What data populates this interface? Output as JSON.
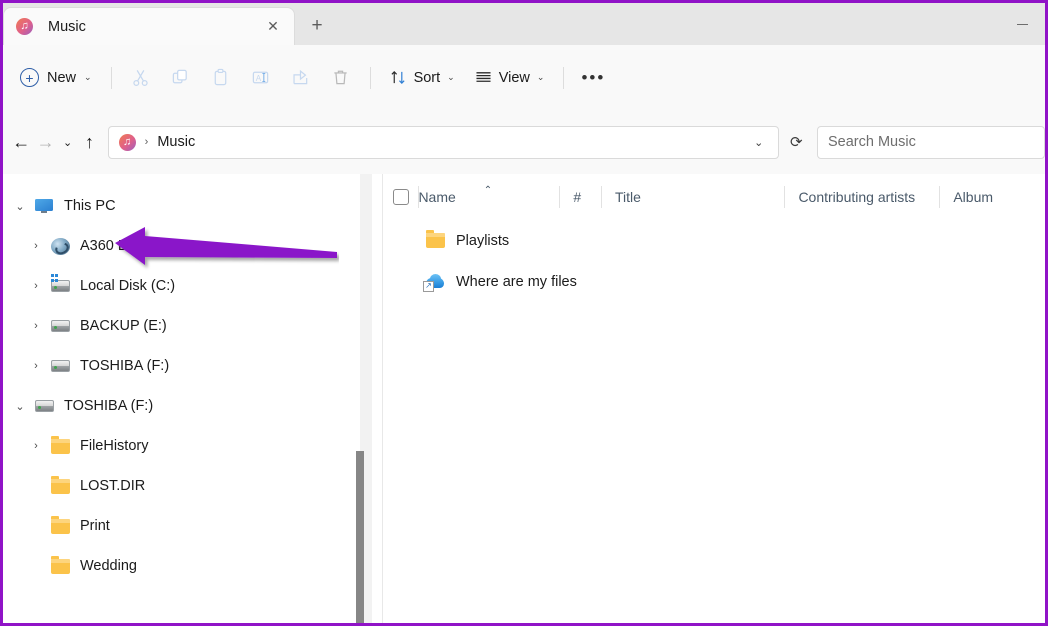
{
  "window": {
    "accent_border_color": "#9013c7",
    "titlebar_bg": "#e6e6e6",
    "toolbar_bg": "#f9f9f9"
  },
  "titlebar": {
    "tab": {
      "title": "Music",
      "icon": "music-note-icon",
      "close_label": "✕"
    },
    "new_tab_label": "+",
    "minimize_label": "—"
  },
  "toolbar": {
    "new_label": "New",
    "new_chevron": "⌄",
    "cut_icon": "cut-icon",
    "copy_icon": "copy-icon",
    "paste_icon": "paste-icon",
    "rename_icon": "rename-icon",
    "share_icon": "share-icon",
    "delete_icon": "delete-icon",
    "sort_label": "Sort",
    "sort_chevron": "⌄",
    "view_label": "View",
    "view_chevron": "⌄",
    "more_label": "•••"
  },
  "navbar": {
    "back_label": "←",
    "forward_label": "→",
    "recent_label": "⌄",
    "up_label": "↑",
    "address": {
      "icon": "music-note-icon",
      "separator": "›",
      "crumb": "Music",
      "dropdown_label": "⌄",
      "refresh_label": "⟳"
    },
    "search": {
      "placeholder": "Search Music",
      "value": ""
    }
  },
  "sidebar": {
    "items": [
      {
        "label": "This PC",
        "icon": "monitor-icon",
        "chevron": "⌄",
        "expanded": true,
        "indent": 1
      },
      {
        "label": "A360 Drive",
        "icon": "a360-drive-icon",
        "chevron": "›",
        "expanded": false,
        "indent": 2
      },
      {
        "label": "Local Disk (C:)",
        "icon": "drive-windows-icon",
        "chevron": "›",
        "expanded": false,
        "indent": 2
      },
      {
        "label": "BACKUP (E:)",
        "icon": "drive-icon",
        "chevron": "›",
        "expanded": false,
        "indent": 2
      },
      {
        "label": "TOSHIBA (F:)",
        "icon": "drive-icon",
        "chevron": "›",
        "expanded": false,
        "indent": 2
      },
      {
        "label": "TOSHIBA (F:)",
        "icon": "drive-icon",
        "chevron": "⌄",
        "expanded": true,
        "indent": 1
      },
      {
        "label": "FileHistory",
        "icon": "folder-icon",
        "chevron": "›",
        "expanded": false,
        "indent": 2
      },
      {
        "label": "LOST.DIR",
        "icon": "folder-icon",
        "chevron": "",
        "expanded": false,
        "indent": 2
      },
      {
        "label": "Print",
        "icon": "folder-icon",
        "chevron": "",
        "expanded": false,
        "indent": 2
      },
      {
        "label": "Wedding",
        "icon": "folder-icon",
        "chevron": "",
        "expanded": false,
        "indent": 2
      }
    ]
  },
  "file_list": {
    "columns": [
      {
        "key": "name",
        "label": "Name",
        "sorted": "asc",
        "sort_caret": "⌃"
      },
      {
        "key": "number",
        "label": "#",
        "sorted": ""
      },
      {
        "key": "title",
        "label": "Title",
        "sorted": ""
      },
      {
        "key": "artists",
        "label": "Contributing artists",
        "sorted": ""
      },
      {
        "key": "album",
        "label": "Album",
        "sorted": ""
      }
    ],
    "rows": [
      {
        "name": "Playlists",
        "icon": "folder-icon",
        "number": "",
        "title": "",
        "artists": "",
        "album": ""
      },
      {
        "name": "Where are my files",
        "icon": "onedrive-cloud-shortcut-icon",
        "shortcut_badge": "↗",
        "number": "",
        "title": "",
        "artists": "",
        "album": ""
      }
    ]
  },
  "annotation": {
    "arrow_color": "#8a17c9",
    "points_at": "This PC"
  }
}
